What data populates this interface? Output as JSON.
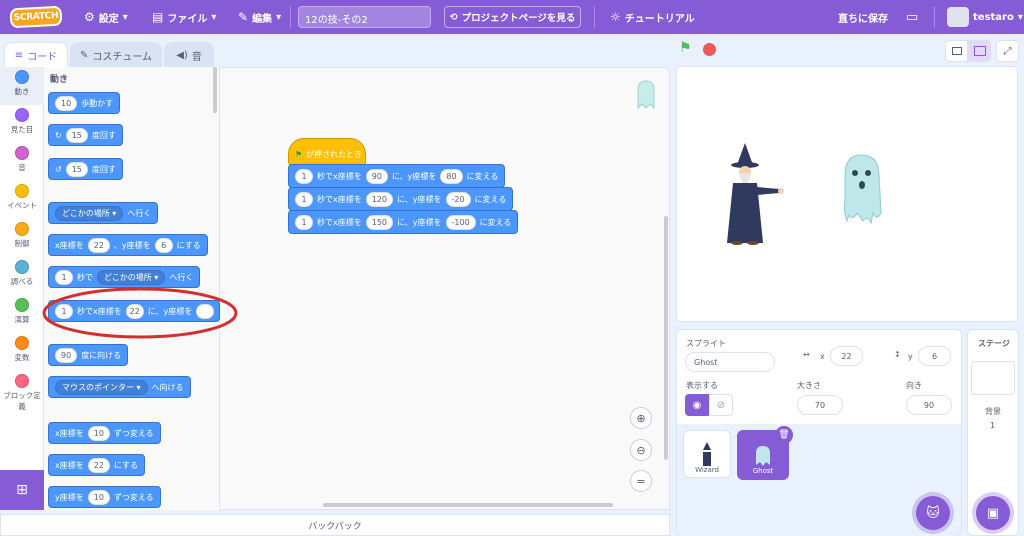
{
  "menu": {
    "logo": "SCRATCH",
    "settings": "設定",
    "file": "ファイル",
    "edit": "編集",
    "project_title": "12の技-その2",
    "share": "プロジェクトページを見る",
    "tutorial": "チュートリアル",
    "save_now": "直ちに保存",
    "username": "testaro"
  },
  "tabs": {
    "code": "コード",
    "costume": "コスチューム",
    "sound": "音"
  },
  "categories": [
    {
      "label": "動き",
      "color": "#4c97ff"
    },
    {
      "label": "見た目",
      "color": "#9966ff"
    },
    {
      "label": "音",
      "color": "#cf63cf"
    },
    {
      "label": "イベント",
      "color": "#ffbf00"
    },
    {
      "label": "制御",
      "color": "#ffab19"
    },
    {
      "label": "調べる",
      "color": "#5cb1d6"
    },
    {
      "label": "演算",
      "color": "#59c059"
    },
    {
      "label": "変数",
      "color": "#ff8c1a"
    },
    {
      "label": "ブロック定義",
      "color": "#ff6680"
    }
  ],
  "palette": {
    "heading": "動き",
    "move": {
      "value": "10",
      "text": "歩動かす"
    },
    "turn_right": {
      "value": "15",
      "text": "度回す"
    },
    "turn_left": {
      "value": "15",
      "text": "度回す"
    },
    "goto": {
      "dropdown": "どこかの場所",
      "text": "へ行く"
    },
    "gotoxy": {
      "t1": "x座標を",
      "x": "22",
      "t2": "、y座標を",
      "y": "6",
      "t3": "にする"
    },
    "glide": {
      "value": "1",
      "t1": "秒で",
      "dropdown": "どこかの場所",
      "t2": "へ行く"
    },
    "glidexy": {
      "value": "1",
      "t1": "秒でx座標を",
      "x": "22",
      "t2": "に、y座標を"
    },
    "point": {
      "value": "90",
      "text": "度に向ける"
    },
    "pointtowards": {
      "dropdown": "マウスのポインター",
      "text": "へ向ける"
    },
    "changex": {
      "t1": "x座標を",
      "value": "10",
      "t2": "ずつ変える"
    },
    "setx": {
      "t1": "x座標を",
      "value": "22",
      "t2": "にする"
    },
    "changey": {
      "t1": "y座標を",
      "value": "10",
      "t2": "ずつ変える"
    }
  },
  "script": {
    "hat": "が押されたとき",
    "rows": [
      {
        "secs": "1",
        "t1": "秒でx座標を",
        "x": "90",
        "t2": "に、y座標を",
        "y": "80",
        "t3": "に変える"
      },
      {
        "secs": "1",
        "t1": "秒でx座標を",
        "x": "120",
        "t2": "に、y座標を",
        "y": "-20",
        "t3": "に変える"
      },
      {
        "secs": "1",
        "t1": "秒でx座標を",
        "x": "150",
        "t2": "に、y座標を",
        "y": "-100",
        "t3": "に変える"
      }
    ]
  },
  "zoom": {
    "reset": "="
  },
  "backpack": "バックパック",
  "sprite_info": {
    "label_sprite": "スプライト",
    "name": "Ghost",
    "x_label": "x",
    "x": "22",
    "y_label": "y",
    "y": "6",
    "show_label": "表示する",
    "size_label": "大きさ",
    "size": "70",
    "direction_label": "向き",
    "direction": "90"
  },
  "sprites": [
    {
      "name": "Wizard"
    },
    {
      "name": "Ghost"
    }
  ],
  "stage_pane": {
    "title": "ステージ",
    "backdrop_label": "背景",
    "backdrop_count": "1"
  },
  "colors": {
    "accent": "#855cd6",
    "motion": "#4c97ff",
    "events": "#ffbf00",
    "highlight": "#d32f2f"
  }
}
